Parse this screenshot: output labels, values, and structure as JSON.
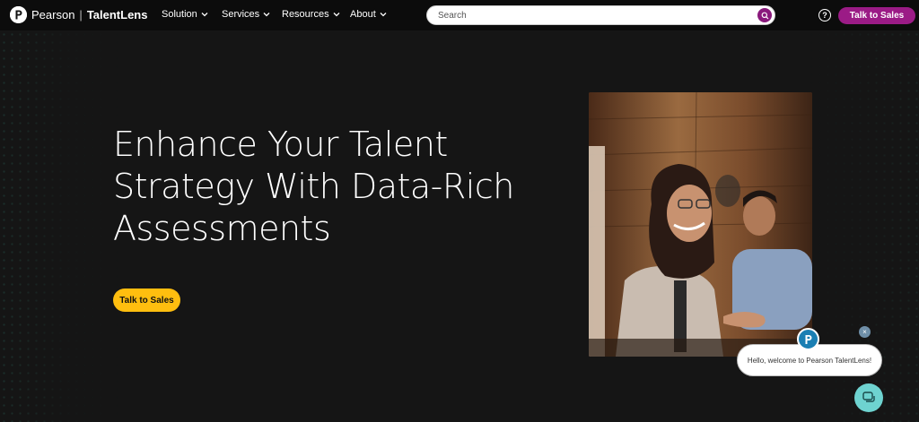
{
  "header": {
    "logo_text": "Pearson",
    "logo_sub": "TalentLens",
    "nav": [
      {
        "label": "Solution"
      },
      {
        "label": "Services"
      },
      {
        "label": "Resources"
      },
      {
        "label": "About"
      }
    ],
    "search": {
      "placeholder": "Search",
      "value": ""
    },
    "help_label": "?",
    "talk_to_sales": "Talk to Sales"
  },
  "hero": {
    "title_line1": "Enhance Your Talent",
    "title_line2": "Strategy With Data-Rich",
    "title_line3": "Assessments",
    "cta": "Talk to Sales"
  },
  "chat": {
    "greeting": "Hello, welcome to Pearson TalentLens!",
    "close_label": "×"
  },
  "colors": {
    "brand_purple": "#9b1b86",
    "cta_yellow": "#ffbe0f",
    "chat_teal": "#6ed3d0",
    "background": "#151515"
  }
}
